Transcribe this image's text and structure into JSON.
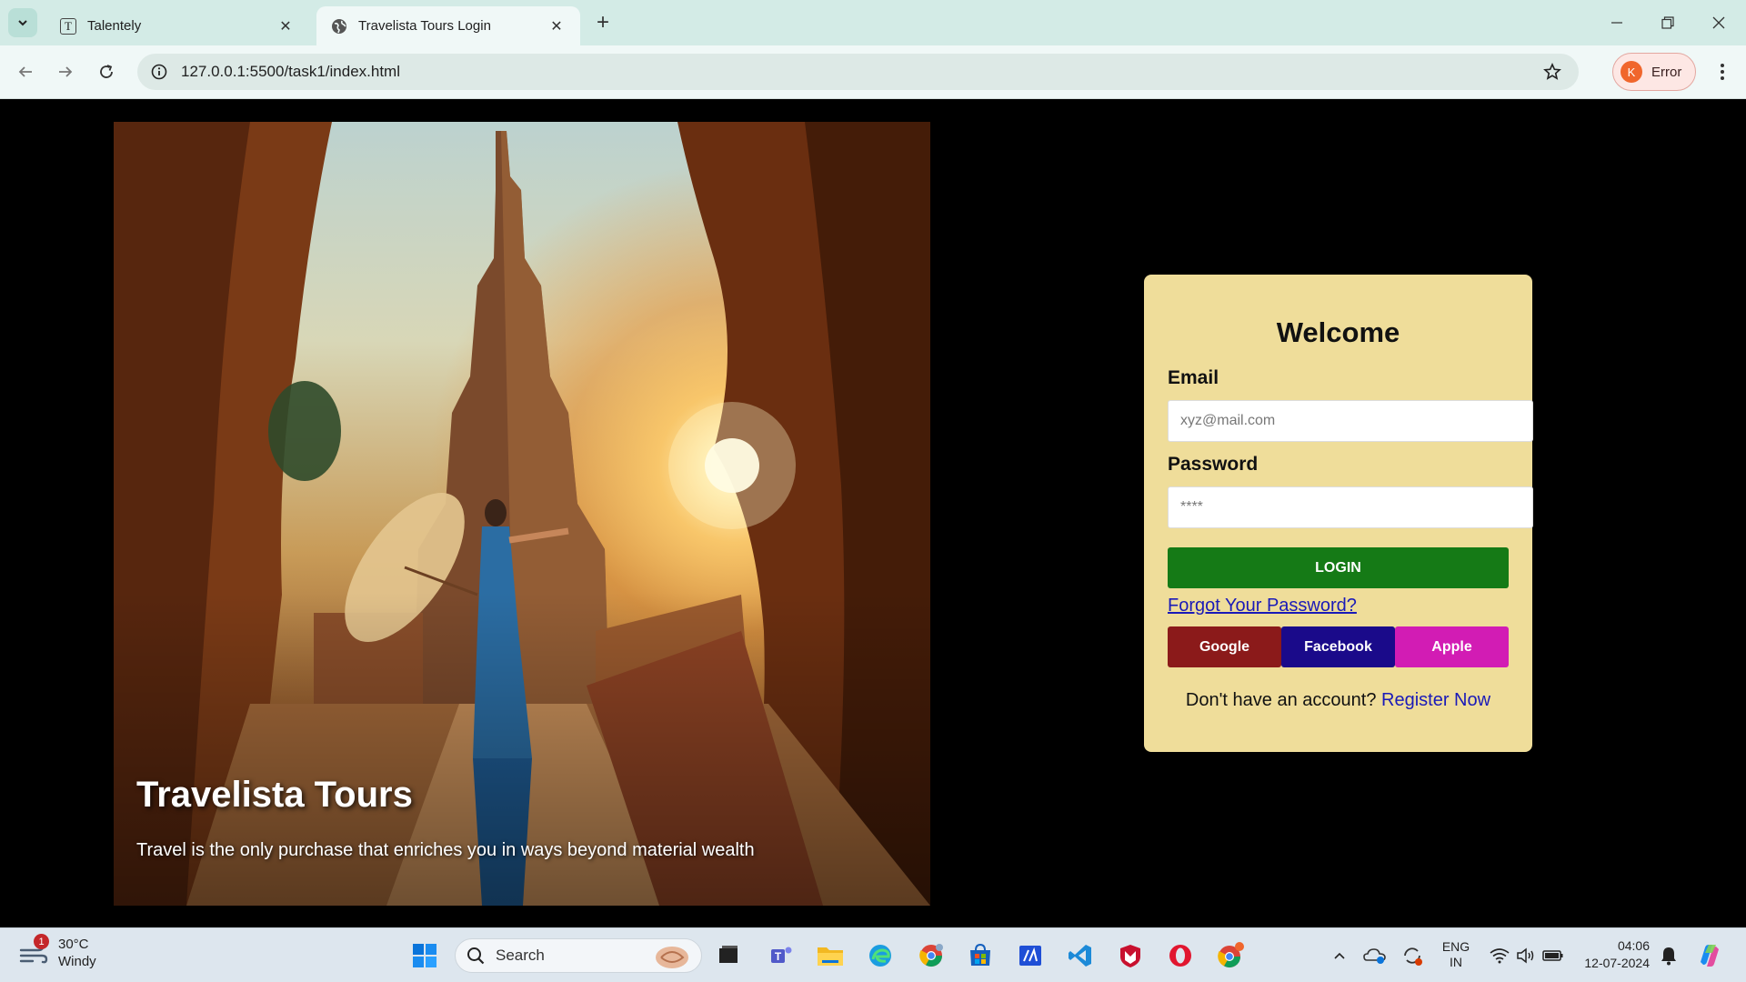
{
  "browser": {
    "tabs": [
      {
        "title": "Talentely",
        "favicon": "T"
      },
      {
        "title": "Travelista Tours Login"
      }
    ],
    "url": "127.0.0.1:5500/task1/index.html",
    "profile": {
      "initial": "K",
      "label": "Error"
    }
  },
  "hero": {
    "title": "Travelista Tours",
    "tagline": "Travel is the only purchase that enriches you in ways beyond material wealth"
  },
  "login": {
    "heading": "Welcome",
    "email_label": "Email",
    "email_placeholder": "xyz@mail.com",
    "password_label": "Password",
    "password_placeholder": "****",
    "login_button": "LOGIN",
    "forgot_link": "Forgot Your Password?",
    "social": [
      {
        "label": "Google",
        "color": "#8b1a1a"
      },
      {
        "label": "Facebook",
        "color": "#1a0a8a"
      },
      {
        "label": "Apple",
        "color": "#d21cb4"
      }
    ],
    "register_prompt": "Don't have an account?",
    "register_link": "Register Now",
    "colors": {
      "card": "#efdd9a",
      "login_button": "#157a16",
      "link": "#1a1ab8"
    }
  },
  "taskbar": {
    "weather": {
      "temp": "30°C",
      "condition": "Windy",
      "badge": "1"
    },
    "search_label": "Search",
    "language": {
      "line1": "ENG",
      "line2": "IN"
    },
    "time": "04:06",
    "date": "12-07-2024"
  }
}
